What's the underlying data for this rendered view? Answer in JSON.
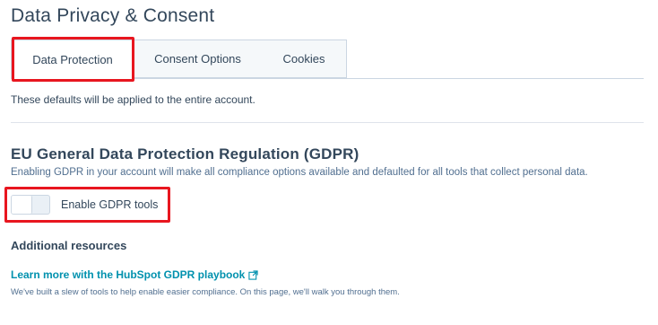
{
  "page": {
    "title": "Data Privacy & Consent"
  },
  "tabs": [
    {
      "label": "Data Protection",
      "active": true
    },
    {
      "label": "Consent Options",
      "active": false
    },
    {
      "label": "Cookies",
      "active": false
    }
  ],
  "defaults_text": "These defaults will be applied to the entire account.",
  "gdpr": {
    "heading": "EU General Data Protection Regulation (GDPR)",
    "description": "Enabling GDPR in your account will make all compliance options available and defaulted for all tools that collect personal data.",
    "toggle_label": "Enable GDPR tools",
    "toggle_on": false
  },
  "resources": {
    "heading": "Additional resources",
    "link_label": "Learn more with the HubSpot GDPR playbook",
    "link_icon": "external-link-icon",
    "link_description": "We've built a slew of tools to help enable easier compliance. On this page, we'll walk you through them."
  },
  "colors": {
    "highlight": "#e8161f",
    "link": "#0091ae",
    "text": "#33475b",
    "muted_text": "#516f90"
  }
}
